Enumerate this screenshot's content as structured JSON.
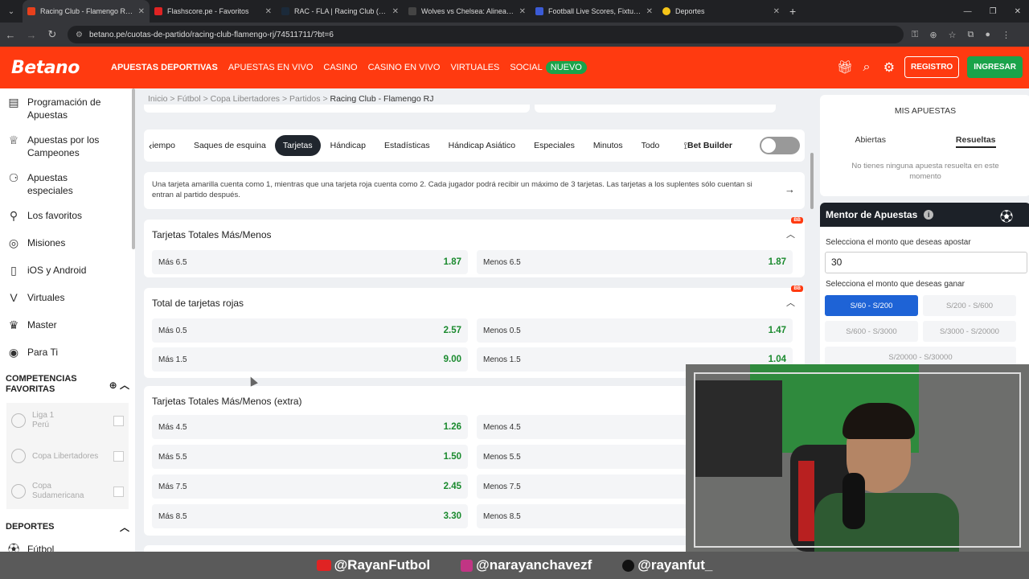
{
  "browser": {
    "tabs": [
      {
        "title": "Racing Club - Flamengo RJ Fútb",
        "color": "#e8401c",
        "active": true
      },
      {
        "title": "Flashscore.pe - Favoritos",
        "color": "#e02323",
        "active": false
      },
      {
        "title": "RAC - FLA | Racing Club (Arg) v",
        "color": "#1b2a3a",
        "active": false
      },
      {
        "title": "Wolves vs Chelsea: Alineacione",
        "color": "#444444",
        "active": false
      },
      {
        "title": "Football Live Scores, Fixtures &",
        "color": "#3b5bd6",
        "active": false
      },
      {
        "title": "Deportes",
        "color": "#f5c518",
        "active": false
      }
    ],
    "url": "betano.pe/cuotas-de-partido/racing-club-flamengo-rj/74511711/?bt=6"
  },
  "header": {
    "logo": "Betano",
    "nav": [
      "APUESTAS DEPORTIVAS",
      "APUESTAS EN VIVO",
      "CASINO",
      "CASINO EN VIVO",
      "VIRTUALES",
      "SOCIAL"
    ],
    "nuevo_badge": "NUEVO",
    "registro": "REGISTRO",
    "ingresar": "INGRESAR",
    "brand_color": "#ff3a10"
  },
  "sidebar": {
    "items": [
      {
        "label": "Programación de Apuestas",
        "icon": "ticket-icon"
      },
      {
        "label": "Apuestas por los Campeones",
        "icon": "trophy-icon"
      },
      {
        "label": "Apuestas especiales",
        "icon": "special-icon"
      },
      {
        "label": "Los favoritos",
        "icon": "pin-icon"
      },
      {
        "label": "Misiones",
        "icon": "target-icon"
      },
      {
        "label": "iOS y Android",
        "icon": "phone-icon"
      },
      {
        "label": "Virtuales",
        "icon": "virtual-icon"
      },
      {
        "label": "Master",
        "icon": "master-icon"
      },
      {
        "label": "Para Ti",
        "icon": "user-icon"
      }
    ],
    "competencias_title": "COMPETENCIAS FAVORITAS",
    "competencias": [
      "Liga 1 Perú",
      "Copa Libertadores",
      "Copa Sudamericana"
    ],
    "deportes_title": "DEPORTES",
    "deportes_first": "Fútbol"
  },
  "main": {
    "breadcrumb": [
      "Inicio",
      "Fútbol",
      "Copa Libertadores",
      "Partidos"
    ],
    "breadcrumb_current": "Racing Club - Flamengo RJ",
    "tabs": [
      "iempo",
      "Saques de esquina",
      "Tarjetas",
      "Hándicap",
      "Estadísticas",
      "Hándicap Asiático",
      "Especiales",
      "Minutos",
      "Todo"
    ],
    "active_tab": "Tarjetas",
    "bet_builder": "Bet Builder",
    "info": "Una tarjeta amarilla cuenta como 1, mientras que una tarjeta roja cuenta como 2. Cada jugador podrá recibir un máximo de 3 tarjetas. Las tarjetas a los suplentes sólo cuentan si entran al partido después.",
    "markets": [
      {
        "title": "Tarjetas Totales Más/Menos",
        "bb": "BB",
        "rows": [
          {
            "l": "Más 6.5",
            "lv": "1.87",
            "r": "Menos 6.5",
            "rv": "1.87"
          }
        ]
      },
      {
        "title": "Total de tarjetas rojas",
        "bb": "BB",
        "rows": [
          {
            "l": "Más 0.5",
            "lv": "2.57",
            "r": "Menos 0.5",
            "rv": "1.47"
          },
          {
            "l": "Más 1.5",
            "lv": "9.00",
            "r": "Menos 1.5",
            "rv": "1.04"
          }
        ]
      },
      {
        "title": "Tarjetas Totales Más/Menos (extra)",
        "bb": "",
        "rows": [
          {
            "l": "Más 4.5",
            "lv": "1.26",
            "r": "Menos 4.5",
            "rv": ""
          },
          {
            "l": "Más 5.5",
            "lv": "1.50",
            "r": "Menos 5.5",
            "rv": ""
          },
          {
            "l": "Más 7.5",
            "lv": "2.45",
            "r": "Menos 7.5",
            "rv": ""
          },
          {
            "l": "Más 8.5",
            "lv": "3.30",
            "r": "Menos 8.5",
            "rv": ""
          }
        ]
      }
    ]
  },
  "right": {
    "mis_apuestas": "MIS APUESTAS",
    "tab_abiertas": "Abiertas",
    "tab_resueltas": "Resueltas",
    "empty": "No tienes ninguna apuesta resuelta en este momento",
    "mentor_title": "Mentor de Apuestas",
    "monto_label": "Selecciona el monto que deseas apostar",
    "monto_value": "30",
    "ganar_label": "Selecciona el monto que deseas ganar",
    "ranges": [
      "S/60 - S/200",
      "S/200 - S/600",
      "S/600 - S/3000",
      "S/3000 - S/20000",
      "S/20000 - S/30000"
    ]
  },
  "footer": {
    "youtube": "@RayanFutbol",
    "instagram": "@narayanchavezf",
    "tiktok": "@rayanfut_"
  }
}
